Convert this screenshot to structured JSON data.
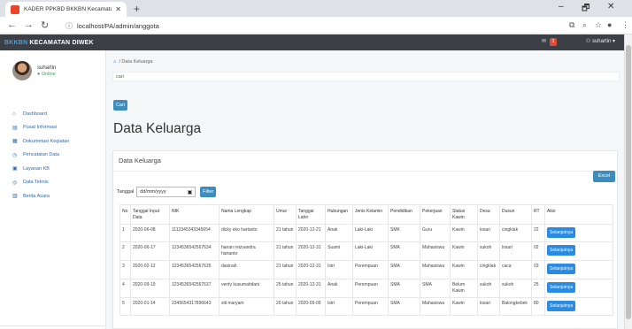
{
  "browser": {
    "tab_title": "KADER PPKBD BKKBN Kecamatan",
    "new_tab": "+",
    "url": "localhost/PA/admin/anggota",
    "win_min": "–",
    "win_max": "🗗",
    "win_close": "✕"
  },
  "header": {
    "brand_prefix": "BKKBN",
    "brand_rest": " KECAMATAN DIWEK",
    "user_label": "suhartin",
    "badge_count": "1"
  },
  "sidebar": {
    "user_name": "suhartin",
    "user_status": "Online",
    "items": [
      {
        "label": "Dashboard",
        "icon": "dashboard-icon"
      },
      {
        "label": "Pusat Informasi",
        "icon": "info-icon"
      },
      {
        "label": "Dokumetasi Kegiatan",
        "icon": "document-icon"
      },
      {
        "label": "Pencatatan Data",
        "icon": "record-icon"
      },
      {
        "label": "Layanan KB",
        "icon": "service-icon"
      },
      {
        "label": "Data Teknis",
        "icon": "data-icon"
      },
      {
        "label": "Berita Acara",
        "icon": "news-icon"
      }
    ]
  },
  "main": {
    "breadcrumb": "Data Keluarga",
    "search_value": "cari",
    "cari_button": "Cari",
    "page_title": "Data Keluarga",
    "card_title": "Data Keluarga",
    "excel_button": "Excel",
    "filter_label": "Tanggal",
    "date_placeholder": "dd/mm/yyyy",
    "filter_button": "Filter",
    "columns": [
      "No",
      "Tanggal Input Data",
      "NIK",
      "Nama Lengkap",
      "Umur",
      "Tanggal Lahir",
      "Hubungan",
      "Jenis Kelamin",
      "Pendidikan",
      "Pekerjaan",
      "Status Kawin",
      "Desa",
      "Dusun",
      "RT",
      "Aksi"
    ],
    "rows": [
      [
        "1",
        "2020-06-08",
        "1112345343345654",
        "dicky eko hartanto",
        "21 tahun",
        "2020-12-21",
        "Anak",
        "Laki-Laki",
        "SMK",
        "Guru",
        "Kawin",
        "losari",
        "cingklak",
        "22",
        "Selanjutnya"
      ],
      [
        "2",
        "2020-06-17",
        "1234536542567634",
        "hanan reizvandra hartanto",
        "21 tahun",
        "2020-12-31",
        "Suami",
        "Laki-Laki",
        "SMA",
        "Mahasiswa",
        "Kawin",
        "sukoh",
        "losari",
        "02",
        "Selanjutnya"
      ],
      [
        "3",
        "2020-02-12",
        "1234536542567635",
        "dasinah",
        "21 tahun",
        "2020-12-31",
        "Istri",
        "Perempuan",
        "SMA",
        "Mahasiswa",
        "Kawin",
        "cingklak",
        "caca",
        "03",
        "Selanjutnya"
      ],
      [
        "4",
        "2020-09-19",
        "1234536542567637",
        "venty kusumahdani",
        "25 tahun",
        "2020-12-31",
        "Anak",
        "Perempuan",
        "SMA",
        "SMA",
        "Belum Kawin",
        "sukoh",
        "sukoh",
        "25",
        "Selanjutnya"
      ],
      [
        "5",
        "2020-01-14",
        "2345654317896643",
        "siti maryam",
        "20 tahun",
        "2020-05-09",
        "Istri",
        "Perempuan",
        "SMA",
        "Mahasiswa",
        "Kawin",
        "losari",
        "Balongkebek",
        "80",
        "Selanjutnya"
      ]
    ]
  }
}
